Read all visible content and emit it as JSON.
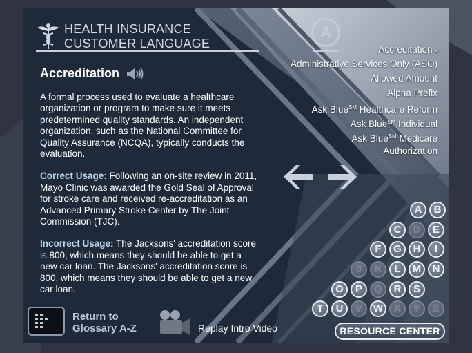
{
  "header": {
    "title_line1": "HEALTH INSURANCE",
    "title_line2": "CUSTOMER LANGUAGE"
  },
  "term": {
    "name": "Accreditation",
    "definition": "A formal process used to evaluate a healthcare organization or program to make sure it meets predetermined quality standards. An independent organization, such as the National Committee for Quality Assurance (NCQA), typically conducts the evaluation.",
    "correct_label": "Correct Usage:",
    "correct_text": "Following an on-site review in 2011, Mayo Clinic was awarded the Gold Seal of Approval for stroke care and received re-accreditation as an Advanced Primary Stroke Center by The Joint Commission (TJC).",
    "incorrect_label": "Incorrect Usage:",
    "incorrect_text": "The Jacksons' accreditation score is 800, which means they should be able to get a new car loan. The Jacksons' accreditation score is 800, which means they should be able to get a new car loan."
  },
  "current_letter": "A",
  "term_list": [
    {
      "pre": "Accreditation",
      "sup": "",
      "post": "",
      "current": true
    },
    {
      "pre": "Administrative Services Only (ASO)",
      "sup": "",
      "post": "",
      "current": false
    },
    {
      "pre": "Allowed Amount",
      "sup": "",
      "post": "",
      "current": false
    },
    {
      "pre": "Alpha Prefix",
      "sup": "",
      "post": "",
      "current": false
    },
    {
      "pre": "Ask Blue",
      "sup": "SM",
      "post": " Healthcare Reform",
      "current": false
    },
    {
      "pre": "Ask Blue",
      "sup": "SM",
      "post": " Individual",
      "current": false
    },
    {
      "pre": "Ask Blue",
      "sup": "SM",
      "post": " Medicare",
      "current": false
    },
    {
      "pre": "Authorization",
      "sup": "",
      "post": "",
      "current": false
    }
  ],
  "current_marker": "◂",
  "alphabet": [
    {
      "l": "A",
      "on": true
    },
    {
      "l": "B",
      "on": true
    },
    {
      "l": "C",
      "on": true
    },
    {
      "l": "D",
      "on": false
    },
    {
      "l": "E",
      "on": true
    },
    {
      "l": "F",
      "on": true
    },
    {
      "l": "G",
      "on": true
    },
    {
      "l": "H",
      "on": true
    },
    {
      "l": "I",
      "on": true
    },
    {
      "l": "J",
      "on": false
    },
    {
      "l": "K",
      "on": false
    },
    {
      "l": "L",
      "on": true
    },
    {
      "l": "M",
      "on": true
    },
    {
      "l": "N",
      "on": true
    },
    {
      "l": "O",
      "on": true
    },
    {
      "l": "P",
      "on": true
    },
    {
      "l": "Q",
      "on": false
    },
    {
      "l": "R",
      "on": true
    },
    {
      "l": "S",
      "on": true
    },
    {
      "l": "T",
      "on": true
    },
    {
      "l": "U",
      "on": true
    },
    {
      "l": "V",
      "on": false
    },
    {
      "l": "W",
      "on": true
    },
    {
      "l": "X",
      "on": false
    },
    {
      "l": "Y",
      "on": false
    },
    {
      "l": "Z",
      "on": false
    }
  ],
  "footer": {
    "return_line1": "Return to",
    "return_line2": "Glossary A-Z",
    "replay_label": "Replay Intro Video",
    "resource_label": "RESOURCE CENTER"
  },
  "icons": {
    "logo": "caduceus-icon",
    "speaker": "speaker-icon",
    "prev": "arrow-left-icon",
    "next": "arrow-right-icon",
    "return": "grid-menu-icon",
    "camera": "video-camera-icon"
  },
  "colors": {
    "panel": "#1e2a3a",
    "accent_label": "#b9d6ee",
    "outer_bg": "#2f3440"
  }
}
